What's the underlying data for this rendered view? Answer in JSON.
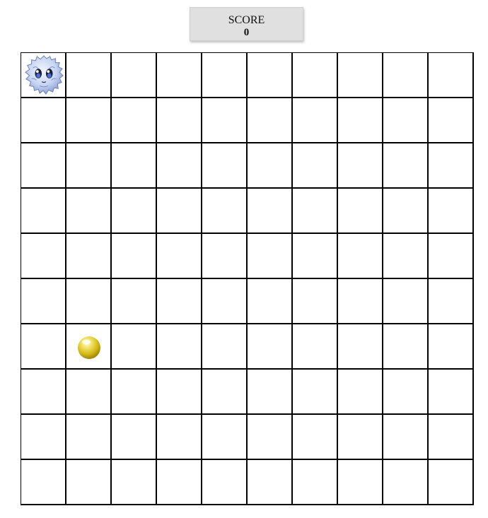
{
  "score": {
    "label": "SCORE",
    "value": "0"
  },
  "board": {
    "rows": 10,
    "cols": 10,
    "player": {
      "row": 0,
      "col": 0,
      "icon": "fluffy-creature-icon"
    },
    "coin": {
      "row": 6,
      "col": 1,
      "icon": "gold-coin-icon"
    }
  },
  "colors": {
    "grid_line": "#000000",
    "score_bg": "#e0e0e0",
    "creature_fur": "#c9d6f2",
    "coin_gold": "#d8c21a"
  }
}
